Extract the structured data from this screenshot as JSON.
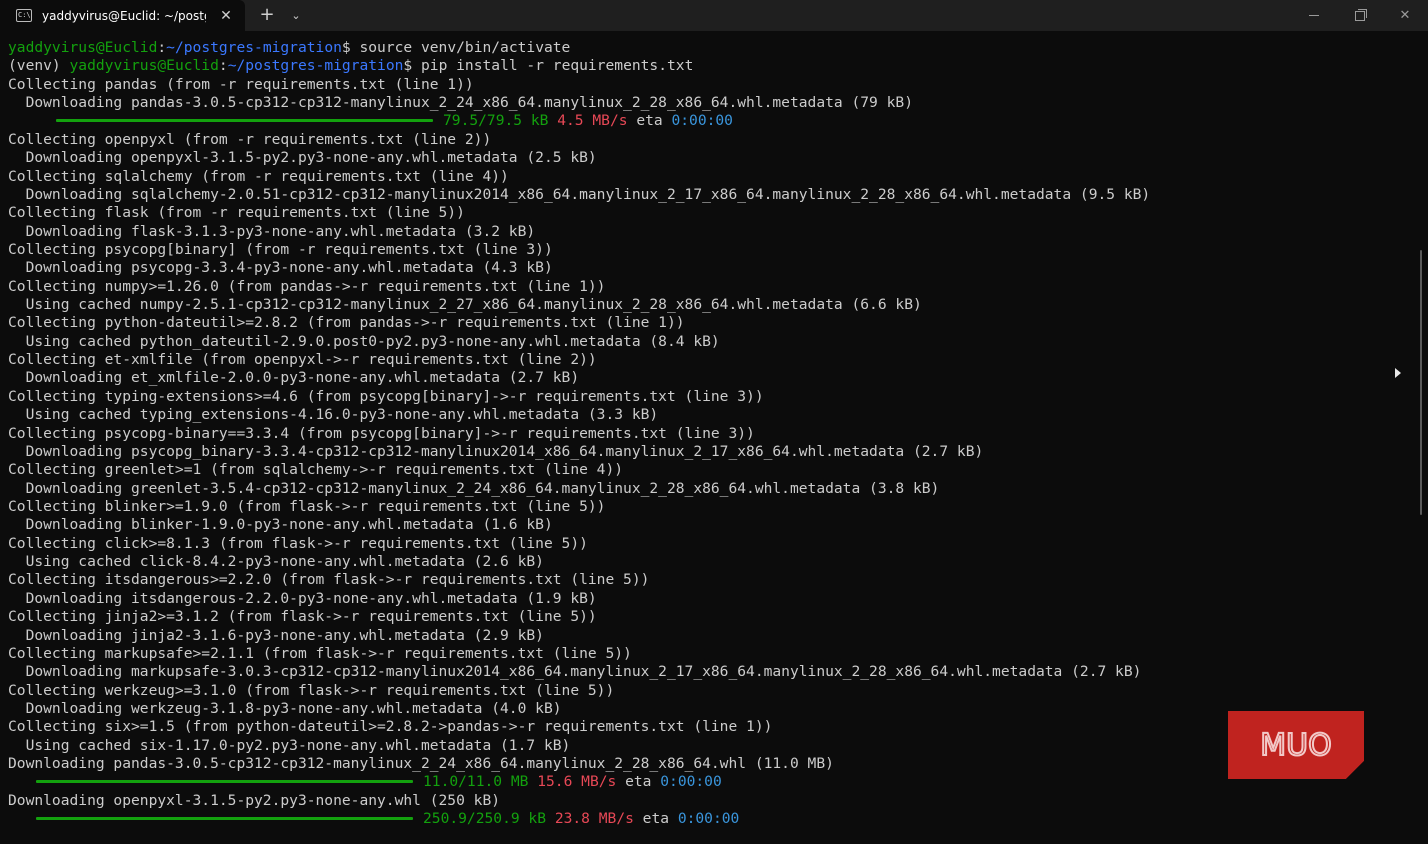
{
  "window": {
    "tab_title": "yaddyvirus@Euclid: ~/postgres-migration",
    "tab_icon": "terminal-icon",
    "new_tab_symbol": "+",
    "dropdown_symbol": "⌄",
    "close_symbol": "✕",
    "window_close_symbol": "✕"
  },
  "prompt": {
    "user_host": "yaddyvirus@Euclid",
    "path": "~/postgres-migration",
    "venv": "(venv) "
  },
  "commands": {
    "cmd1": "$ source venv/bin/activate",
    "cmd2": "$ pip install -r requirements.txt"
  },
  "output": {
    "l3": "Collecting pandas (from -r requirements.txt (line 1))",
    "l4": "  Downloading pandas-3.0.5-cp312-cp312-manylinux_2_24_x86_64.manylinux_2_28_x86_64.whl.metadata (79 kB)",
    "p1": {
      "size": "79.5/79.5 kB",
      "speed": "4.5 MB/s",
      "eta_label": " eta ",
      "eta": "0:00:00",
      "progress": 1.0
    },
    "l6": "Collecting openpyxl (from -r requirements.txt (line 2))",
    "l7": "  Downloading openpyxl-3.1.5-py2.py3-none-any.whl.metadata (2.5 kB)",
    "l8": "Collecting sqlalchemy (from -r requirements.txt (line 4))",
    "l9": "  Downloading sqlalchemy-2.0.51-cp312-cp312-manylinux2014_x86_64.manylinux_2_17_x86_64.manylinux_2_28_x86_64.whl.metadata (9.5 kB)",
    "l10": "Collecting flask (from -r requirements.txt (line 5))",
    "l11": "  Downloading flask-3.1.3-py3-none-any.whl.metadata (3.2 kB)",
    "l12": "Collecting psycopg[binary] (from -r requirements.txt (line 3))",
    "l13": "  Downloading psycopg-3.3.4-py3-none-any.whl.metadata (4.3 kB)",
    "l14": "Collecting numpy>=1.26.0 (from pandas->-r requirements.txt (line 1))",
    "l15": "  Using cached numpy-2.5.1-cp312-cp312-manylinux_2_27_x86_64.manylinux_2_28_x86_64.whl.metadata (6.6 kB)",
    "l16": "Collecting python-dateutil>=2.8.2 (from pandas->-r requirements.txt (line 1))",
    "l17": "  Using cached python_dateutil-2.9.0.post0-py2.py3-none-any.whl.metadata (8.4 kB)",
    "l18": "Collecting et-xmlfile (from openpyxl->-r requirements.txt (line 2))",
    "l19": "  Downloading et_xmlfile-2.0.0-py3-none-any.whl.metadata (2.7 kB)",
    "l20": "Collecting typing-extensions>=4.6 (from psycopg[binary]->-r requirements.txt (line 3))",
    "l21": "  Using cached typing_extensions-4.16.0-py3-none-any.whl.metadata (3.3 kB)",
    "l22": "Collecting psycopg-binary==3.3.4 (from psycopg[binary]->-r requirements.txt (line 3))",
    "l23": "  Downloading psycopg_binary-3.3.4-cp312-cp312-manylinux2014_x86_64.manylinux_2_17_x86_64.whl.metadata (2.7 kB)",
    "l24": "Collecting greenlet>=1 (from sqlalchemy->-r requirements.txt (line 4))",
    "l25": "  Downloading greenlet-3.5.4-cp312-cp312-manylinux_2_24_x86_64.manylinux_2_28_x86_64.whl.metadata (3.8 kB)",
    "l26": "Collecting blinker>=1.9.0 (from flask->-r requirements.txt (line 5))",
    "l27": "  Downloading blinker-1.9.0-py3-none-any.whl.metadata (1.6 kB)",
    "l28": "Collecting click>=8.1.3 (from flask->-r requirements.txt (line 5))",
    "l29": "  Using cached click-8.4.2-py3-none-any.whl.metadata (2.6 kB)",
    "l30": "Collecting itsdangerous>=2.2.0 (from flask->-r requirements.txt (line 5))",
    "l31": "  Downloading itsdangerous-2.2.0-py3-none-any.whl.metadata (1.9 kB)",
    "l32": "Collecting jinja2>=3.1.2 (from flask->-r requirements.txt (line 5))",
    "l33": "  Downloading jinja2-3.1.6-py3-none-any.whl.metadata (2.9 kB)",
    "l34": "Collecting markupsafe>=2.1.1 (from flask->-r requirements.txt (line 5))",
    "l35": "  Downloading markupsafe-3.0.3-cp312-cp312-manylinux2014_x86_64.manylinux_2_17_x86_64.manylinux_2_28_x86_64.whl.metadata (2.7 kB)",
    "l36": "Collecting werkzeug>=3.1.0 (from flask->-r requirements.txt (line 5))",
    "l37": "  Downloading werkzeug-3.1.8-py3-none-any.whl.metadata (4.0 kB)",
    "l38": "Collecting six>=1.5 (from python-dateutil>=2.8.2->pandas->-r requirements.txt (line 1))",
    "l39": "  Using cached six-1.17.0-py2.py3-none-any.whl.metadata (1.7 kB)",
    "l40": "Downloading pandas-3.0.5-cp312-cp312-manylinux_2_24_x86_64.manylinux_2_28_x86_64.whl (11.0 MB)",
    "p2": {
      "size": "11.0/11.0 MB",
      "speed": "15.6 MB/s",
      "eta_label": " eta ",
      "eta": "0:00:00",
      "progress": 1.0
    },
    "l42": "Downloading openpyxl-3.1.5-py2.py3-none-any.whl (250 kB)",
    "p3": {
      "size": "250.9/250.9 kB",
      "speed": "23.8 MB/s",
      "eta_label": " eta ",
      "eta": "0:00:00",
      "progress": 1.0
    }
  },
  "watermark": {
    "text": "MUO",
    "color": "#c0231f"
  },
  "colors": {
    "background": "#0c0c0c",
    "text": "#cccccc",
    "prompt_user": "#13a10e",
    "prompt_path": "#3b78ff",
    "speed": "#e74856",
    "eta": "#3a96dd"
  }
}
